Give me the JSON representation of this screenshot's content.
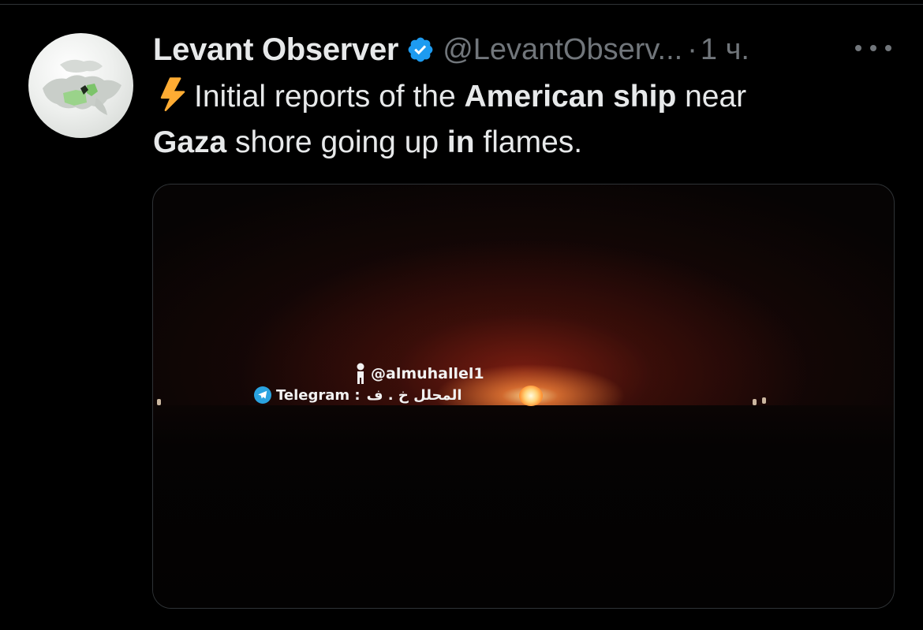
{
  "tweet": {
    "author_name": "Levant Observer",
    "author_handle": "@LevantObserv...",
    "separator": "·",
    "time": "1 ч.",
    "text": {
      "p1": "Initial reports of the ",
      "b1": "American ship",
      "p2": " near",
      "b2": "Gaza",
      "p3": " shore going up ",
      "b3": "in",
      "p4": " flames."
    }
  },
  "media": {
    "watermark_handle": "@almuhallel1",
    "watermark_telegram": "Telegram :",
    "watermark_arabic": "المحلل خ . ف"
  },
  "icons": {
    "verified": "verified-badge-icon",
    "more": "more-options-icon",
    "zap": "high-voltage-emoji-icon",
    "telegram": "telegram-icon"
  },
  "colors": {
    "background": "#000000",
    "text": "#e7e9ea",
    "secondary": "#71767b",
    "verified": "#1d9bf0",
    "zap": "#ffac33"
  }
}
